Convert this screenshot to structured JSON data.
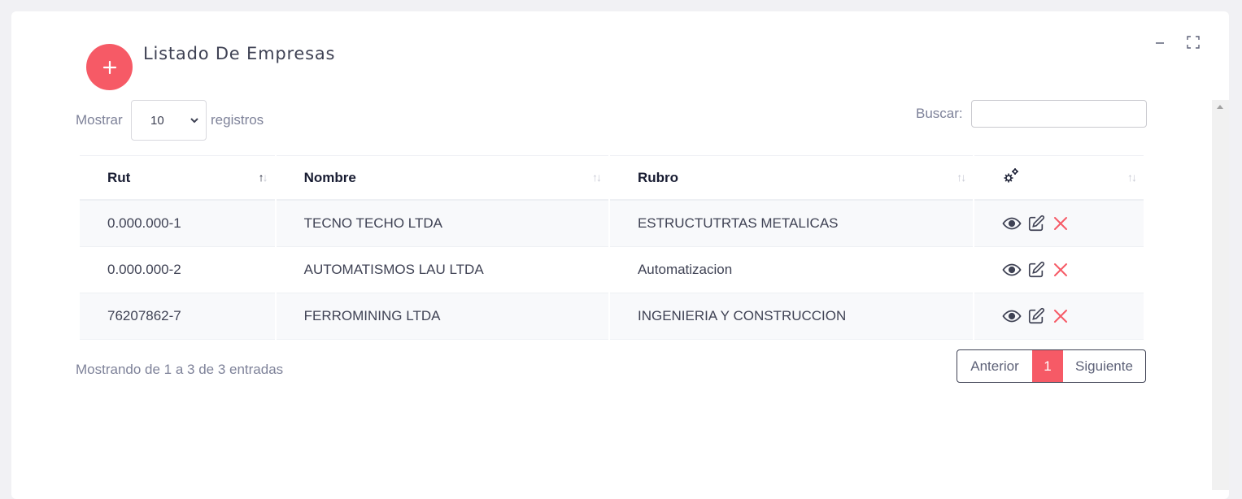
{
  "header": {
    "title": "Listado De Empresas",
    "accent_color": "#f65a66"
  },
  "controls": {
    "show_label": "Mostrar",
    "page_size": "10",
    "records_label": "registros",
    "search_label": "Buscar:",
    "search_value": ""
  },
  "table": {
    "columns": [
      "Rut",
      "Nombre",
      "Rubro"
    ],
    "actions_column_icon": "gears-icon",
    "rows": [
      {
        "rut": "0.000.000-1",
        "nombre": "TECNO TECHO LTDA",
        "rubro": "ESTRUCTUTRTAS METALICAS"
      },
      {
        "rut": "0.000.000-2",
        "nombre": "AUTOMATISMOS LAU LTDA",
        "rubro": "Automatizacion"
      },
      {
        "rut": "76207862-7",
        "nombre": "FERROMINING LTDA",
        "rubro": "INGENIERIA Y CONSTRUCCION"
      }
    ],
    "row_action_icons": [
      "eye-icon",
      "edit-icon",
      "delete-icon"
    ]
  },
  "footer": {
    "info": "Mostrando de 1 a 3 de 3 entradas",
    "prev_label": "Anterior",
    "current_page": "1",
    "next_label": "Siguiente"
  }
}
